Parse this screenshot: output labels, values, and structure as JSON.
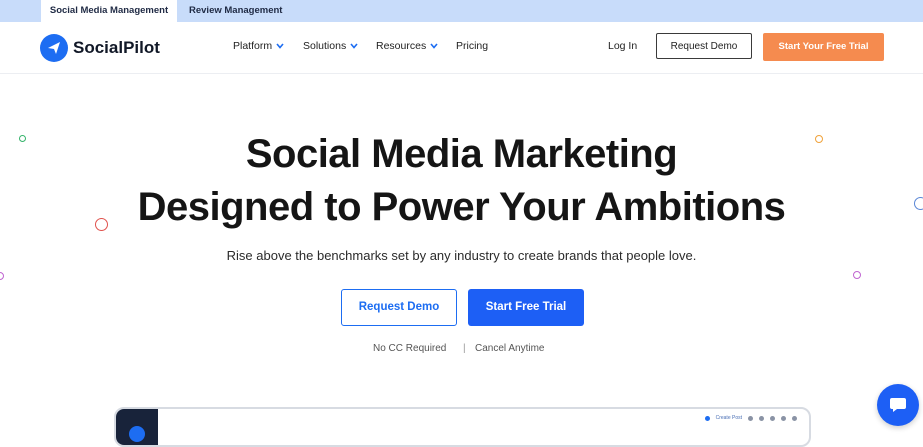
{
  "topbar": {
    "tabs": [
      {
        "label": "Social Media Management",
        "active": true
      },
      {
        "label": "Review Management",
        "active": false
      }
    ]
  },
  "header": {
    "brand": "SocialPilot",
    "nav": [
      {
        "label": "Platform",
        "has_dropdown": true
      },
      {
        "label": "Solutions",
        "has_dropdown": true
      },
      {
        "label": "Resources",
        "has_dropdown": true
      },
      {
        "label": "Pricing",
        "has_dropdown": false
      }
    ],
    "login": "Log In",
    "request_demo": "Request Demo",
    "free_trial": "Start Your Free Trial"
  },
  "hero": {
    "title_line1": "Social Media Marketing",
    "title_line2": "Designed to Power Your Ambitions",
    "subtitle": "Rise above the benchmarks set by any industry to create brands that people love.",
    "request_demo": "Request Demo",
    "start_trial": "Start Free Trial",
    "note_cc": "No CC Required",
    "note_sep": "|",
    "note_cancel": "Cancel Anytime"
  },
  "preview": {
    "create_post": "Create Post"
  },
  "colors": {
    "brand_blue": "#1d5ff5",
    "accent_orange": "#f58b4f",
    "top_strip": "#c8dcfa"
  },
  "icons": [
    "logo-paper-plane-icon",
    "chevron-down-icon",
    "chat-bubble-icon"
  ]
}
